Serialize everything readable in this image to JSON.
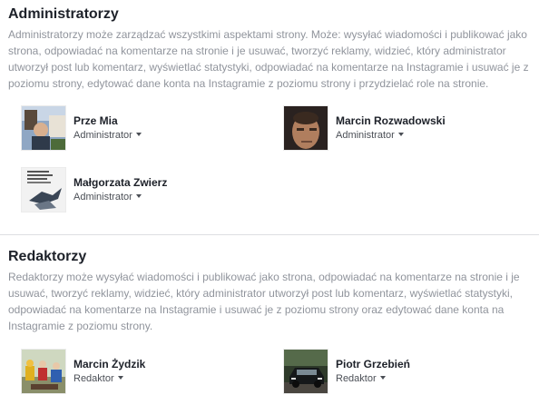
{
  "admins": {
    "title": "Administratorzy",
    "description": "Administratorzy może zarządzać wszystkimi aspektami strony. Może: wysyłać wiadomości i publikować jako strona, odpowiadać na komentarze na stronie i je usuwać, tworzyć reklamy, widzieć, który administrator utworzył post lub komentarz, wyświetlać statystyki, odpowiadać na komentarze na Instagramie i usuwać je z poziomu strony, edytować dane konta na Instagramie z poziomu strony i przydzielać role na stronie.",
    "people": [
      {
        "name": "Prze Mia",
        "role": "Administrator"
      },
      {
        "name": "Marcin Rozwadowski",
        "role": "Administrator"
      },
      {
        "name": "Małgorzata Zwierz",
        "role": "Administrator"
      }
    ]
  },
  "editors": {
    "title": "Redaktorzy",
    "description": "Redaktorzy może wysyłać wiadomości i publikować jako strona, odpowiadać na komentarze na stronie i je usuwać, tworzyć reklamy, widzieć, który administrator utworzył post lub komentarz, wyświetlać statystyki, odpowiadać na komentarze na Instagramie i usuwać je z poziomu strony oraz edytować dane konta na Instagramie z poziomu strony.",
    "people": [
      {
        "name": "Marcin Żydzik",
        "role": "Redaktor"
      },
      {
        "name": "Piotr Grzebień",
        "role": "Redaktor"
      }
    ]
  },
  "colors": {
    "title": "#1d2129",
    "description": "#90949c",
    "role_link": "#4b4f56",
    "divider": "#dddfe2"
  }
}
